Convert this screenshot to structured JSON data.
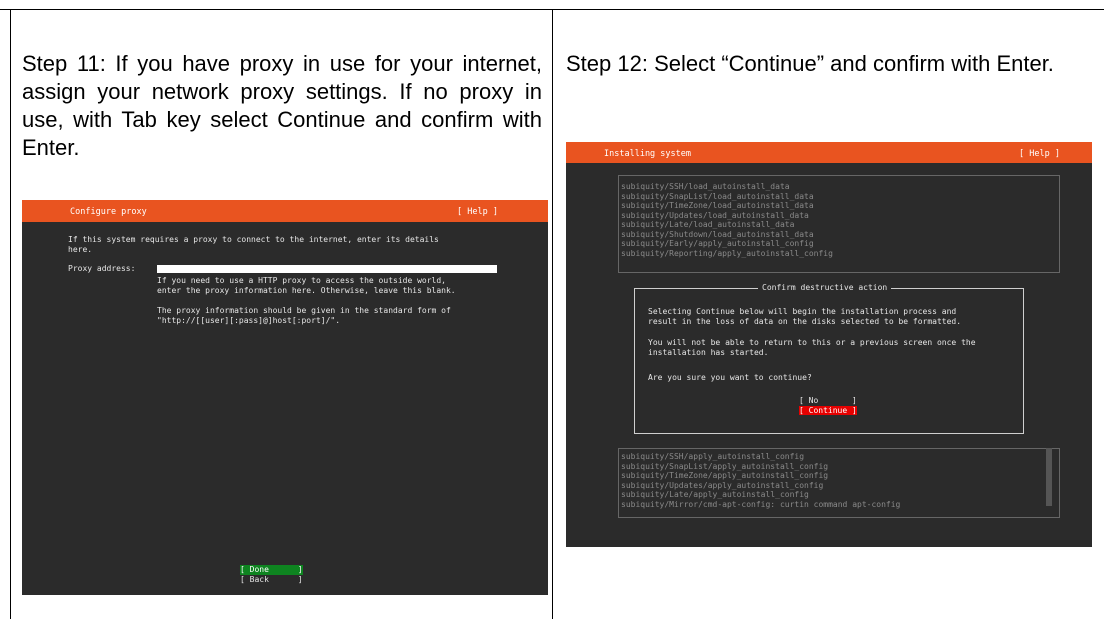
{
  "steps": [
    {
      "text": "Step 11: If you have proxy in use for your internet, assign your network proxy settings. If no proxy in use, with Tab key select Continue and confirm with Enter.",
      "terminal": {
        "title": "Configure proxy",
        "help": "[ Help ]",
        "intro": [
          "If this system requires a proxy to connect to the internet, enter its details",
          "here."
        ],
        "field_label": "Proxy address:",
        "field_value": "",
        "hint": [
          "If you need to use a HTTP proxy to access the outside world,",
          "enter the proxy information here. Otherwise, leave this blank."
        ],
        "hint2": [
          "The proxy information should be given in the standard form of",
          "\"http://[[user][:pass]@]host[:port]/\"."
        ],
        "done_button": "[ Done      ]",
        "back_button": "[ Back      ]"
      }
    },
    {
      "text": "Step 12: Select “Continue” and confirm with Enter.",
      "terminal": {
        "title": "Installing system",
        "help": "[ Help ]",
        "log_top": [
          "subiquity/SSH/load_autoinstall_data",
          "subiquity/SnapList/load_autoinstall_data",
          "subiquity/TimeZone/load_autoinstall_data",
          "subiquity/Updates/load_autoinstall_data",
          "subiquity/Late/load_autoinstall_data",
          "subiquity/Shutdown/load_autoinstall_data",
          "subiquity/Early/apply_autoinstall_config",
          "subiquity/Reporting/apply_autoinstall_config"
        ],
        "dialog_title": "Confirm destructive action",
        "dialog_p1": [
          "Selecting Continue below will begin the installation process and",
          "result in the loss of data on the disks selected to be formatted."
        ],
        "dialog_p2": [
          "You will not be able to return to this or a previous screen once the",
          "installation has started."
        ],
        "dialog_q": "Are you sure you want to continue?",
        "no_button": "[ No       ]",
        "continue_button": "[ Continue ]",
        "log_bottom": [
          "subiquity/SSH/apply_autoinstall_config",
          "subiquity/SnapList/apply_autoinstall_config",
          "subiquity/TimeZone/apply_autoinstall_config",
          "subiquity/Updates/apply_autoinstall_config",
          "subiquity/Late/apply_autoinstall_config",
          "subiquity/Mirror/cmd-apt-config: curtin command apt-config"
        ]
      }
    }
  ],
  "colors": {
    "accent": "#e95420",
    "done_bg": "#0e8420",
    "continue_bg": "#e60000",
    "terminal_bg": "#2b2b2b"
  }
}
